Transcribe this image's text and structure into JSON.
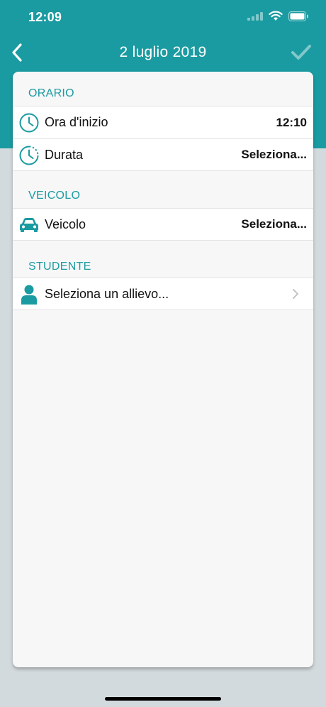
{
  "status_bar": {
    "time": "12:09"
  },
  "nav": {
    "title": "2 luglio 2019"
  },
  "sections": {
    "orario": {
      "header": "ORARIO",
      "rows": [
        {
          "label": "Ora d'inizio",
          "value": "12:10"
        },
        {
          "label": "Durata",
          "value": "Seleziona..."
        }
      ]
    },
    "veicolo": {
      "header": "VEICOLO",
      "rows": [
        {
          "label": "Veicolo",
          "value": "Seleziona..."
        }
      ]
    },
    "studente": {
      "header": "STUDENTE",
      "rows": [
        {
          "label": "Seleziona un allievo..."
        }
      ]
    }
  },
  "colors": {
    "accent": "#1a9ba1",
    "background": "#d3dadd",
    "card": "#f7f7f8"
  },
  "icons": [
    "back-chevron-icon",
    "checkmark-icon",
    "clock-icon",
    "duration-clock-icon",
    "car-icon",
    "person-icon",
    "chevron-right-icon",
    "wifi-icon",
    "battery-icon",
    "signal-icon"
  ]
}
